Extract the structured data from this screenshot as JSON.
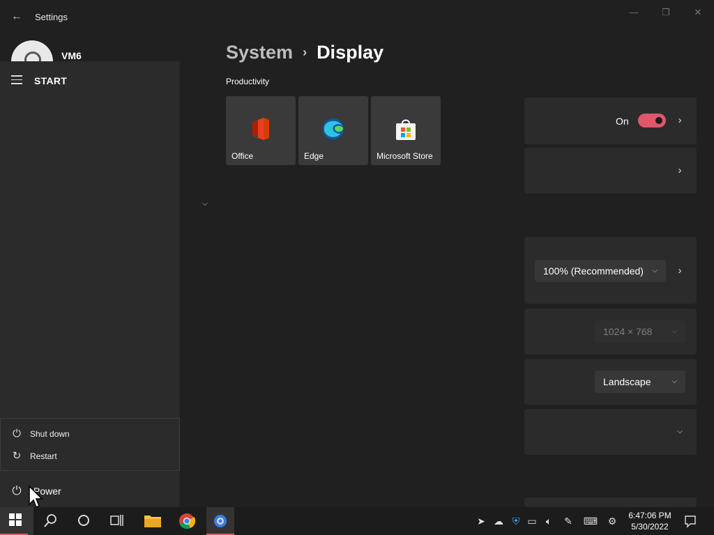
{
  "window": {
    "title": "Settings",
    "back_icon": "←",
    "minimize_icon": "—",
    "maximize_icon": "❐",
    "close_icon": "✕"
  },
  "user": {
    "name": "VM6"
  },
  "breadcrumb": {
    "parent": "System",
    "separator": "›",
    "current": "Display"
  },
  "settings_cards": {
    "hdr_toggle_label": "On",
    "scale_value": "100% (Recommended)",
    "resolution_value": "1024 × 768",
    "orientation_value": "Landscape"
  },
  "start_menu": {
    "label": "START",
    "power_menu": [
      {
        "label": "Shut down",
        "icon": "power-icon"
      },
      {
        "label": "Restart",
        "icon": "restart-icon"
      }
    ],
    "power_label": "Power"
  },
  "tiles": {
    "group_title": "Productivity",
    "items": [
      {
        "label": "Office",
        "icon": "office-icon"
      },
      {
        "label": "Edge",
        "icon": "edge-icon"
      },
      {
        "label": "Microsoft Store",
        "icon": "store-icon"
      }
    ]
  },
  "taskbar": {
    "time": "6:47:06 PM",
    "date": "5/30/2022"
  },
  "colors": {
    "accent": "#e0566a",
    "background": "#202020",
    "card": "#2b2b2b"
  }
}
